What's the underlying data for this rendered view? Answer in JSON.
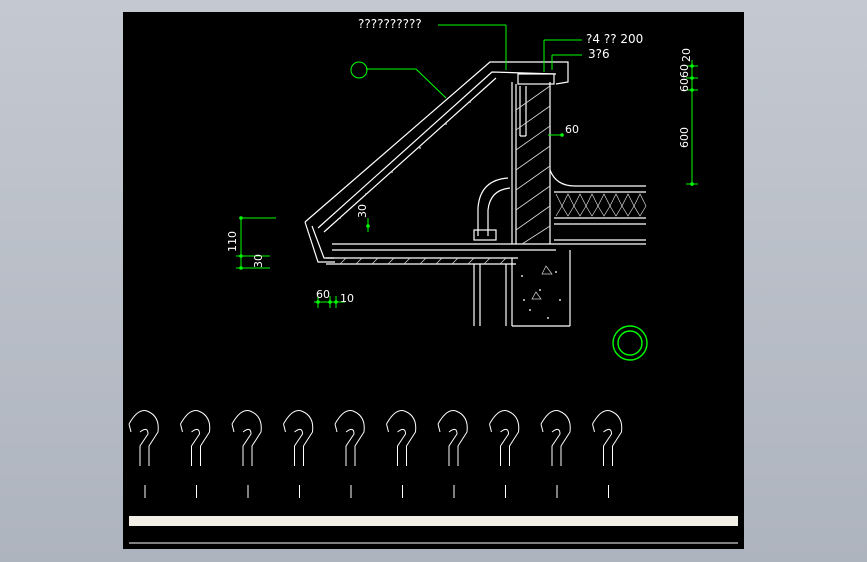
{
  "colors": {
    "viewport_bg": "#000000",
    "frame": "#c8c8c8",
    "linework": "#ffffff",
    "dimension": "#00ff00",
    "leader": "#00ff00",
    "hatch": "#d8d8d8",
    "text": "#ffffff"
  },
  "drawing": {
    "callout_top": "??????????",
    "callout_rebar": "?4 ?? 200",
    "callout_rebar2": "3?6",
    "dim_60_wall": "60",
    "dim_30_gutter": "30",
    "dim_110": "110",
    "dim_30_left": "30",
    "dim_60_bottom": "60",
    "dim_10_bottom": "10",
    "dim_right_20": "20",
    "dim_right_60_upper": "60",
    "dim_right_60_lower": "60",
    "dim_right_600": "600"
  },
  "title_block": {
    "glyph": "?",
    "glyph_count": 10
  },
  "icons": {
    "section_marker": "circle-leader-icon",
    "north_marker": "double-circle-icon"
  }
}
